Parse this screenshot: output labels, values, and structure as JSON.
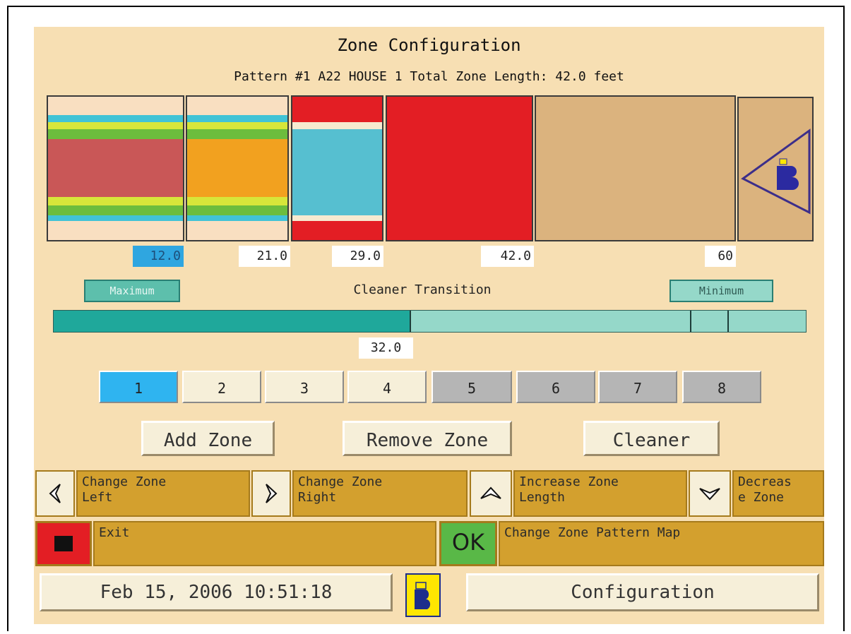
{
  "header": {
    "title": "Zone Configuration",
    "subtitle": "Pattern #1 A22 HOUSE 1 Total Zone Length: 42.0 feet"
  },
  "zone_markers": [
    "12.0",
    "21.0",
    "29.0",
    "42.0",
    "60"
  ],
  "transition": {
    "maximum_label": "Maximum",
    "title": "Cleaner Transition",
    "minimum_label": "Minimum",
    "value": "32.0"
  },
  "pattern_tabs": [
    "1",
    "2",
    "3",
    "4",
    "5",
    "6",
    "7",
    "8"
  ],
  "actions": {
    "add_zone": "Add Zone",
    "remove_zone": "Remove Zone",
    "cleaner": "Cleaner"
  },
  "controls": {
    "change_left": "Change Zone\nLeft",
    "change_right": "Change Zone\nRight",
    "increase": "Increase Zone\nLength",
    "decrease": "Decreas\ne Zone",
    "exit": "Exit",
    "ok": "OK",
    "pattern_map": "Change Zone Pattern Map"
  },
  "status": {
    "datetime": "Feb 15, 2006 10:51:18",
    "screen": "Configuration"
  },
  "colors": {
    "panel_bg": "#f7dfb3",
    "accent_blue": "#2fb4f0",
    "teal": "#1fa89b",
    "gold": "#d3a02e",
    "exit_red": "#e31e24",
    "ok_green": "#59b847"
  }
}
